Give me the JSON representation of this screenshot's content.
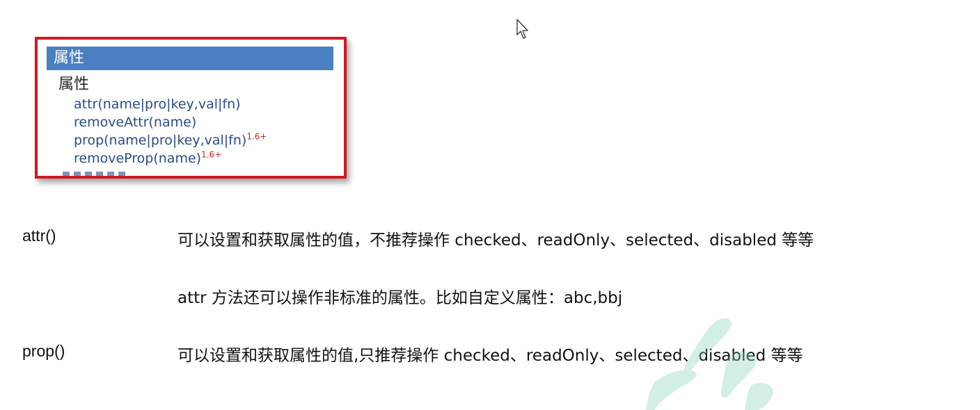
{
  "api_panel": {
    "header": "属性",
    "subheader": "属性",
    "items": [
      {
        "label": "attr(name|pro|key,val|fn)",
        "version": ""
      },
      {
        "label": "removeAttr(name)",
        "version": ""
      },
      {
        "label": "prop(name|pro|key,val|fn)",
        "version": "1.6+"
      },
      {
        "label": "removeProp(name)",
        "version": "1.6+"
      }
    ]
  },
  "document": {
    "attr_term": "attr()",
    "attr_desc": "可以设置和获取属性的值，不推荐操作 checked、readOnly、selected、disabled 等等",
    "attr_note": "attr 方法还可以操作非标准的属性。比如自定义属性：abc,bbj",
    "prop_term": "prop()",
    "prop_desc": "可以设置和获取属性的值,只推荐操作 checked、readOnly、selected、disabled 等等"
  },
  "colors": {
    "panel_border": "#d0191f",
    "header_bg": "#4a7fc1",
    "link_text": "#2a4b8a",
    "version_text": "#c4251f",
    "watermark": "#7fd1bd"
  },
  "icons": {
    "cursor": "mouse-pointer-icon",
    "watermark": "brush-watermark"
  }
}
